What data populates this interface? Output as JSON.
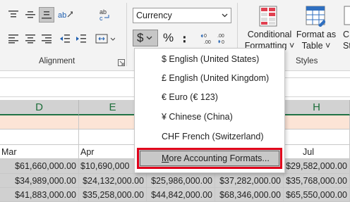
{
  "ribbon": {
    "number_format_value": "Currency",
    "alignment_label": "Alignment",
    "styles_label": "Styles",
    "conditional_formatting": [
      "Conditional",
      "Formatting ˅"
    ],
    "format_as_table": [
      "Format as",
      "Table ˅"
    ],
    "cell_styles": [
      "C",
      "Sty"
    ],
    "accounting_symbol": "$",
    "percent_symbol": "%",
    "comma_symbol": "։",
    "accent_color": "#217346",
    "highlight_color": "#e0001b"
  },
  "accounting_menu": {
    "items": [
      "$ English (United States)",
      "£ English (United Kingdom)",
      "€ Euro (€ 123)",
      "¥ Chinese (China)",
      "CHF French (Switzerland)"
    ],
    "more_formats_label": "More Accounting Formats..."
  },
  "sheet": {
    "column_headers": [
      "D",
      "E",
      "H"
    ],
    "month_labels": [
      "Mar",
      "Apr",
      "Jul"
    ],
    "rows": [
      [
        "$61,660,000.00",
        "$10,690,000",
        "",
        "",
        "$29,582,000.00"
      ],
      [
        "$34,989,000.00",
        "$24,132,000.00",
        "$25,986,000.00",
        "$37,282,000.00",
        "$35,768,000.00"
      ],
      [
        "$41,883,000.00",
        "$35,258,000.00",
        "$44,842,000.00",
        "$68,346,000.00",
        "$65,550,000.00"
      ]
    ]
  }
}
